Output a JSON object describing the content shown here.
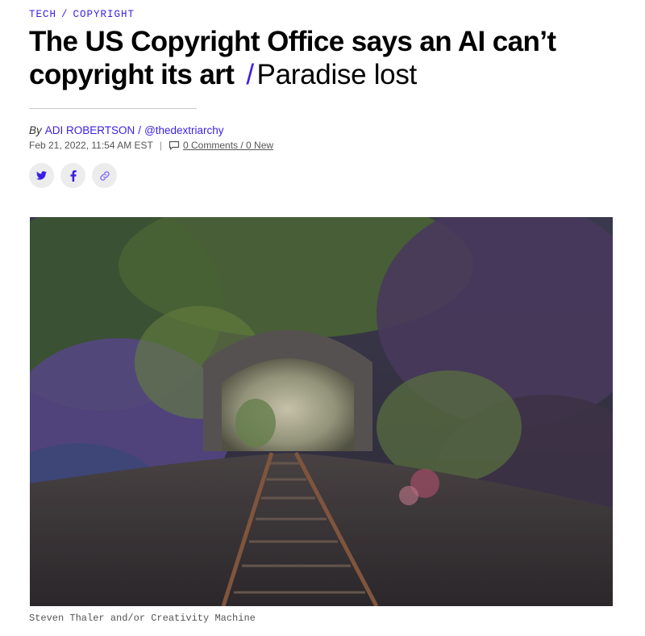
{
  "breadcrumb": {
    "section": "TECH",
    "separator": "/",
    "topic": "COPYRIGHT"
  },
  "article": {
    "title": "The US Copyright Office says an AI can’t copyright its art",
    "title_separator": "/",
    "subtitle": "Paradise lost",
    "byline": {
      "prefix": "By",
      "author": "ADI ROBERTSON",
      "separator": "/",
      "handle": "@thedextriarchy"
    },
    "date": "Feb 21, 2022, 11:54 AM EST",
    "meta_separator": "|",
    "comments": "0 Comments / 0 New"
  },
  "share": {
    "buttons": [
      {
        "icon": "twitter-icon"
      },
      {
        "icon": "facebook-icon"
      },
      {
        "icon": "link-icon"
      }
    ]
  },
  "hero": {
    "caption": "Steven Thaler and/or Creativity Machine"
  },
  "colors": {
    "accent": "#3a1ee8",
    "share_button_bg": "#ececec",
    "rule": "#c8c8c8"
  }
}
